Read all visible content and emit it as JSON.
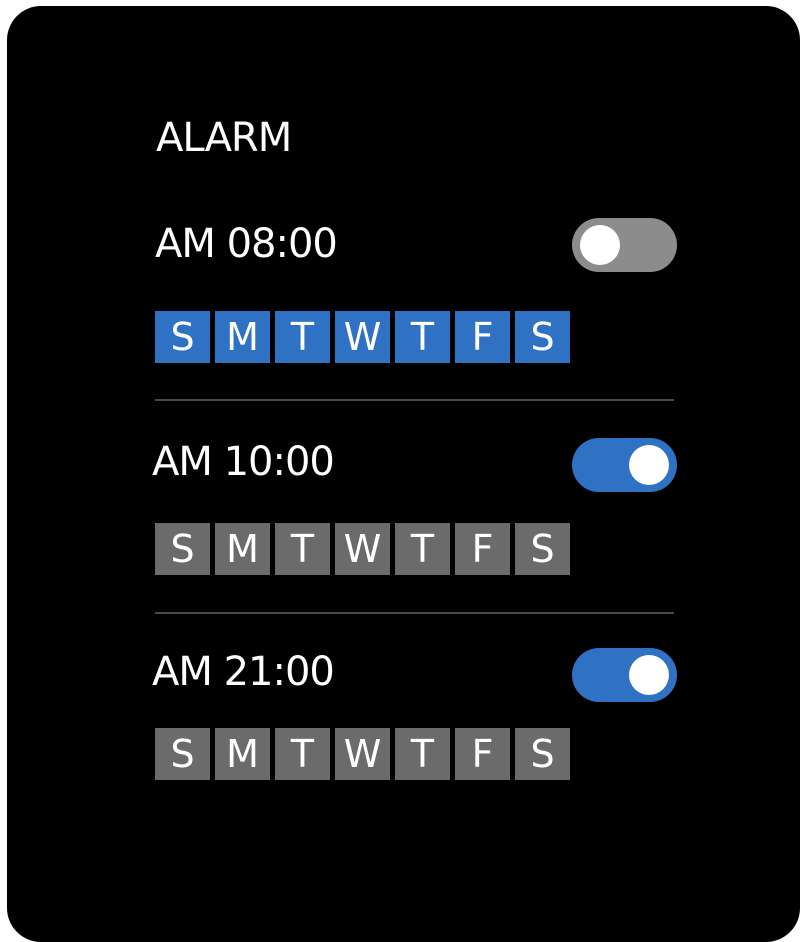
{
  "title": "ALARM",
  "colors": {
    "background": "#000000",
    "accent": "#2f72c4",
    "day_inactive": "#6b6b6b",
    "toggle_off": "#8c8c8c"
  },
  "alarms": [
    {
      "time": "AM 08:00",
      "enabled": false,
      "days_active": true,
      "days": [
        "S",
        "M",
        "T",
        "W",
        "T",
        "F",
        "S"
      ]
    },
    {
      "time": "AM 10:00",
      "enabled": true,
      "days_active": false,
      "days": [
        "S",
        "M",
        "T",
        "W",
        "T",
        "F",
        "S"
      ]
    },
    {
      "time": "AM 21:00",
      "enabled": true,
      "days_active": false,
      "days": [
        "S",
        "M",
        "T",
        "W",
        "T",
        "F",
        "S"
      ]
    }
  ]
}
